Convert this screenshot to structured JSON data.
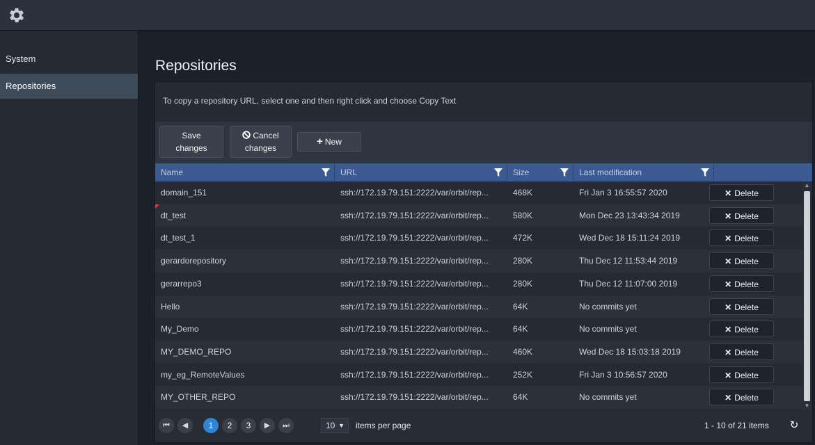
{
  "app": {
    "icon": "gear-icon"
  },
  "sidebar": {
    "items": [
      {
        "label": "System",
        "active": false
      },
      {
        "label": "Repositories",
        "active": true
      }
    ]
  },
  "main": {
    "title": "Repositories",
    "hint": "To copy a repository URL, select one and then right click and choose Copy Text",
    "toolbar": {
      "save_line1": "Save",
      "save_line2": "changes",
      "cancel_line1": "Cancel",
      "cancel_line2": "changes",
      "new_label": "New",
      "new_icon": "plus-icon",
      "cancel_icon": "ban-icon"
    },
    "columns": [
      {
        "label": "Name"
      },
      {
        "label": "URL"
      },
      {
        "label": "Size"
      },
      {
        "label": "Last modification"
      }
    ],
    "delete_label": "Delete",
    "rows": [
      {
        "name": "domain_151",
        "url": "ssh://172.19.79.151:2222/var/orbit/rep...",
        "size": "468K",
        "modified": "Fri Jan 3 16:55:57 2020"
      },
      {
        "name": "dt_test",
        "url": "ssh://172.19.79.151:2222/var/orbit/rep...",
        "size": "580K",
        "modified": "Mon Dec 23 13:43:34 2019",
        "dirty": true
      },
      {
        "name": "dt_test_1",
        "url": "ssh://172.19.79.151:2222/var/orbit/rep...",
        "size": "472K",
        "modified": "Wed Dec 18 15:11:24 2019"
      },
      {
        "name": "gerardorepository",
        "url": "ssh://172.19.79.151:2222/var/orbit/rep...",
        "size": "280K",
        "modified": "Thu Dec 12 11:53:44 2019"
      },
      {
        "name": "gerarrepo3",
        "url": "ssh://172.19.79.151:2222/var/orbit/rep...",
        "size": "280K",
        "modified": "Thu Dec 12 11:07:00 2019"
      },
      {
        "name": "Hello",
        "url": "ssh://172.19.79.151:2222/var/orbit/rep...",
        "size": "64K",
        "modified": "No commits yet"
      },
      {
        "name": "My_Demo",
        "url": "ssh://172.19.79.151:2222/var/orbit/rep...",
        "size": "64K",
        "modified": "No commits yet"
      },
      {
        "name": "MY_DEMO_REPO",
        "url": "ssh://172.19.79.151:2222/var/orbit/rep...",
        "size": "460K",
        "modified": "Wed Dec 18 15:03:18 2019"
      },
      {
        "name": "my_eg_RemoteValues",
        "url": "ssh://172.19.79.151:2222/var/orbit/rep...",
        "size": "252K",
        "modified": "Fri Jan 3 10:56:57 2020"
      },
      {
        "name": "MY_OTHER_REPO",
        "url": "ssh://172.19.79.151:2222/var/orbit/rep...",
        "size": "64K",
        "modified": "No commits yet"
      }
    ],
    "pager": {
      "pages": [
        "1",
        "2",
        "3"
      ],
      "current_page": "1",
      "per_page": "10",
      "per_page_label": "items per page",
      "info": "1 - 10 of 21 items"
    }
  },
  "colors": {
    "header_blue": "#3a5a91",
    "page_selected": "#2f84d8",
    "dirty_marker": "#e53935"
  }
}
